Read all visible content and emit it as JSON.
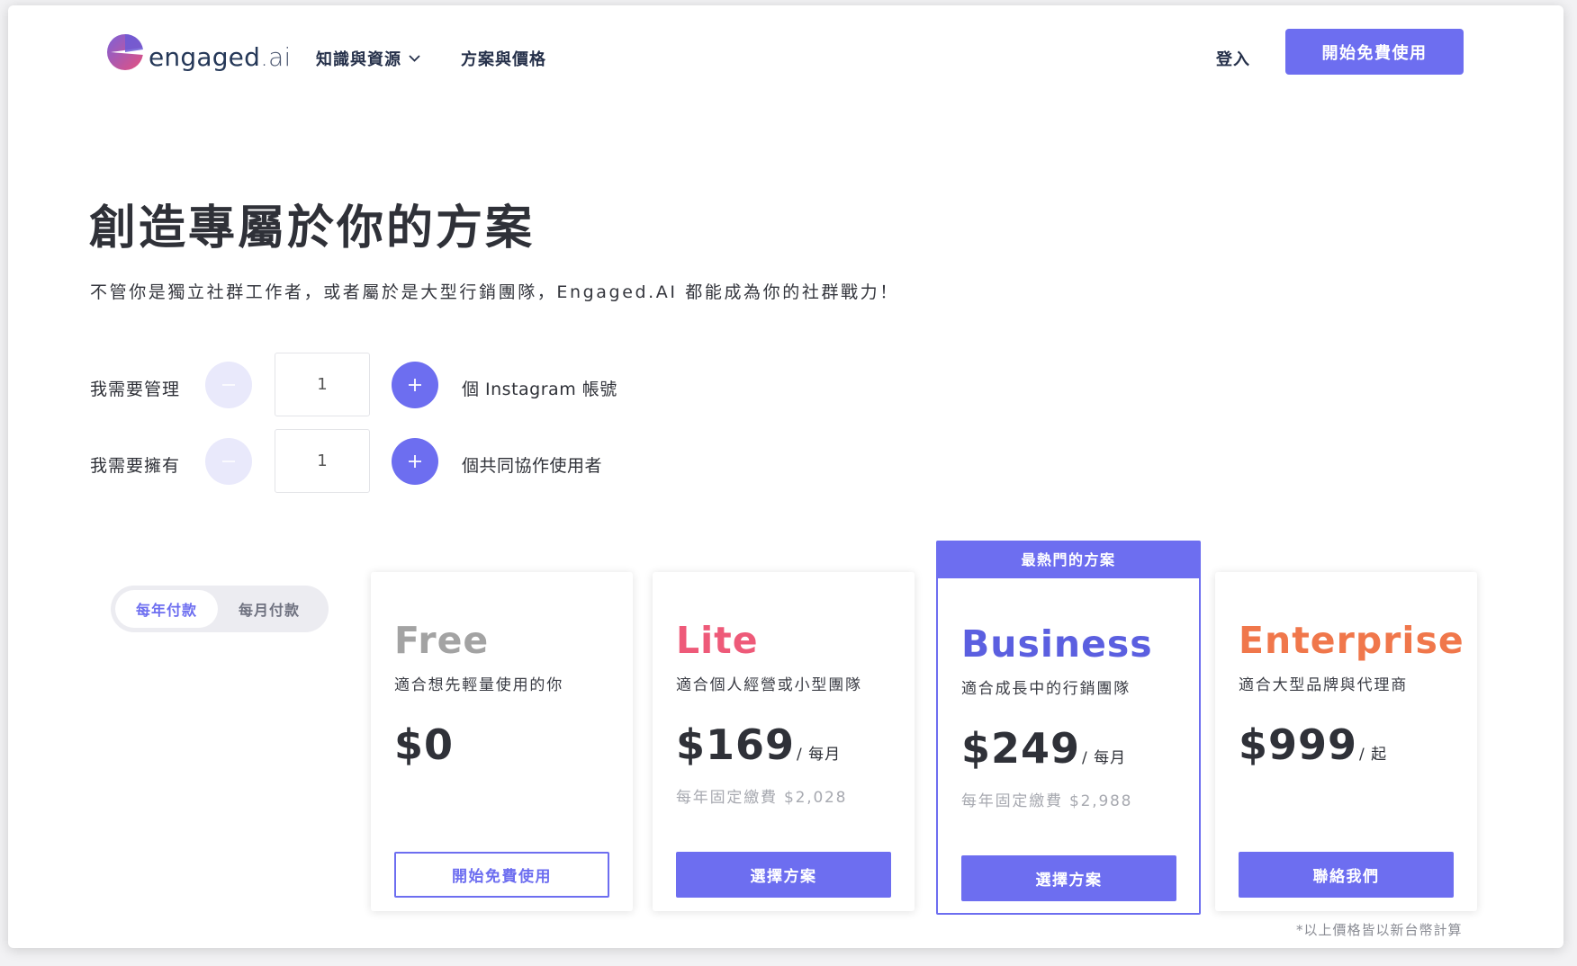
{
  "brand": {
    "logo_text": "engaged",
    "logo_suffix": ".ai",
    "accent": "#6d6ef0"
  },
  "nav": {
    "knowledge_label": "知識與資源",
    "plans_label": "方案與價格",
    "login_label": "登入",
    "cta_label": "開始免費使用"
  },
  "hero": {
    "title": "創造專屬於你的方案",
    "subtitle": "不管你是獨立社群工作者，或者屬於是大型行銷團隊，Engaged.AI 都能成為你的社群戰力！"
  },
  "accounts": {
    "label": "我需要管理",
    "value": "1",
    "suffix": "個 Instagram 帳號"
  },
  "users": {
    "label": "我需要擁有",
    "value": "1",
    "suffix": "個共同協作使用者"
  },
  "billing": {
    "yearly_label": "每年付款",
    "monthly_label": "每月付款",
    "selected": "yearly"
  },
  "plans": [
    {
      "name": "Free",
      "color": "#a3a3a3",
      "desc": "適合想先輕量使用的你",
      "price": "$0",
      "unit": "",
      "annual": "",
      "button": "開始免費使用"
    },
    {
      "name": "Lite",
      "color": "#ee5a79",
      "desc": "適合個人經營或小型團隊",
      "price": "$169",
      "unit": "/ 每月",
      "annual": "每年固定繳費 $2,028",
      "button": "選擇方案"
    },
    {
      "name": "Business",
      "color": "#5b5fe0",
      "desc": "適合成長中的行銷團隊",
      "price": "$249",
      "unit": "/ 每月",
      "annual": "每年固定繳費 $2,988",
      "button": "選擇方案",
      "badge": "最熱門的方案"
    },
    {
      "name": "Enterprise",
      "color": "#f0774b",
      "desc": "適合大型品牌與代理商",
      "price": "$999",
      "unit": "/ 起",
      "annual": "",
      "button": "聯絡我們"
    }
  ],
  "footnote": "*以上價格皆以新台幣計算",
  "icons": {
    "logo": "engaged-logo-icon",
    "chevron": "chevron-down-icon",
    "minus": "minus-icon",
    "plus": "plus-icon"
  }
}
